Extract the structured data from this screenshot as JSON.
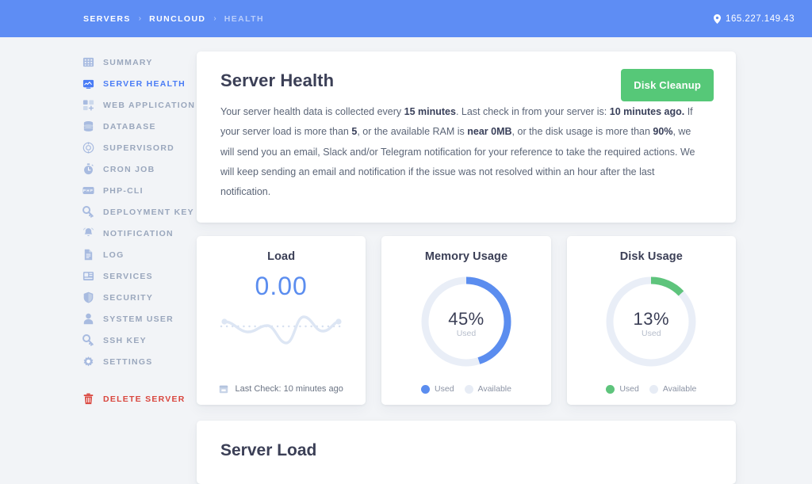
{
  "topbar": {
    "breadcrumbs": [
      {
        "label": "SERVERS",
        "muted": false
      },
      {
        "label": "RUNCLOUD",
        "muted": false
      },
      {
        "label": "HEALTH",
        "muted": true
      }
    ],
    "separator": "›",
    "ip_address": "165.227.149.43",
    "ip_icon": "location-pin-icon",
    "background_color": "#5e8df4"
  },
  "sidebar": {
    "items": [
      {
        "label": "SUMMARY",
        "icon": "grid-summary-icon",
        "active": false
      },
      {
        "label": "SERVER HEALTH",
        "icon": "health-monitor-icon",
        "active": true
      },
      {
        "label": "WEB APPLICATION",
        "icon": "web-application-icon",
        "active": false
      },
      {
        "label": "DATABASE",
        "icon": "database-icon",
        "active": false
      },
      {
        "label": "SUPERVISORD",
        "icon": "supervisord-gear-icon",
        "active": false
      },
      {
        "label": "CRON JOB",
        "icon": "stopwatch-icon",
        "active": false
      },
      {
        "label": "PHP-CLI",
        "icon": "php-badge-icon",
        "active": false
      },
      {
        "label": "DEPLOYMENT KEY",
        "icon": "key-icon",
        "active": false
      },
      {
        "label": "NOTIFICATION",
        "icon": "bell-icon",
        "active": false
      },
      {
        "label": "LOG",
        "icon": "document-icon",
        "active": false
      },
      {
        "label": "SERVICES",
        "icon": "services-icon",
        "active": false
      },
      {
        "label": "SECURITY",
        "icon": "shield-icon",
        "active": false
      },
      {
        "label": "SYSTEM USER",
        "icon": "user-icon",
        "active": false
      },
      {
        "label": "SSH KEY",
        "icon": "key-icon",
        "active": false
      },
      {
        "label": "SETTINGS",
        "icon": "gear-icon",
        "active": false
      }
    ],
    "delete": {
      "label": "DELETE SERVER",
      "icon": "trash-icon",
      "color": "#d9453d"
    },
    "active_color": "#4a7cf5",
    "idle_color": "#9aa7bd"
  },
  "main": {
    "title": "Server Health",
    "cleanup_button": {
      "label": "Disk Cleanup",
      "color": "#56c878"
    },
    "description": {
      "p1_a": "Your server health data is collected every ",
      "p1_b1": "15 minutes",
      "p1_c": ". Last check in from your server is: ",
      "p1_b2": "10 minutes ago.",
      "p1_d": " If your server load is more than ",
      "p1_b3": "5",
      "p1_e": ", or the available RAM is ",
      "p1_b4": "near 0MB",
      "p1_f": ", or the disk usage is more than ",
      "p1_b5": "90%",
      "p1_g": ", we will send you an email, Slack and/or Telegram notification for your reference to take the required actions. We will keep sending an email and notification if the issue was not resolved within an hour after the last notification."
    }
  },
  "stats": {
    "load": {
      "title": "Load",
      "value": "0.00",
      "value_color": "#5b8def",
      "last_check_label": "Last Check: 10 minutes ago",
      "calendar_icon": "calendar-icon"
    },
    "memory": {
      "title": "Memory Usage",
      "percent_label": "45%",
      "sub_label": "Used",
      "used_percent": 45,
      "color": "#5b8def",
      "track_color": "#e9eef7",
      "legend": [
        {
          "label": "Used",
          "color": "#5b8def"
        },
        {
          "label": "Available",
          "color": "#e7ecf5"
        }
      ]
    },
    "disk": {
      "title": "Disk Usage",
      "percent_label": "13%",
      "sub_label": "Used",
      "used_percent": 13,
      "color": "#5ec47c",
      "track_color": "#e9eef7",
      "legend": [
        {
          "label": "Used",
          "color": "#5ec47c"
        },
        {
          "label": "Available",
          "color": "#e7ecf5"
        }
      ]
    }
  },
  "server_load": {
    "title": "Server Load"
  },
  "chart_data": [
    {
      "type": "line",
      "title": "Load",
      "series": [
        {
          "name": "Load",
          "values": [
            0.35,
            0.18,
            0.12,
            0.3,
            0.42,
            0.3,
            0.06,
            -0.35,
            0.05,
            0.55,
            0.72,
            0.35,
            0.1,
            0.22,
            0.16,
            0.4
          ]
        }
      ],
      "x": [
        0,
        1,
        2,
        3,
        4,
        5,
        6,
        7,
        8,
        9,
        10,
        11,
        12,
        13,
        14,
        15
      ],
      "ylabel": "",
      "xlabel": "",
      "grid": false,
      "legend": "none"
    },
    {
      "type": "pie",
      "title": "Memory Usage",
      "categories": [
        "Used",
        "Available"
      ],
      "values": [
        45,
        55
      ],
      "colors": [
        "#5b8def",
        "#e7ecf5"
      ],
      "legend": "bottom"
    },
    {
      "type": "pie",
      "title": "Disk Usage",
      "categories": [
        "Used",
        "Available"
      ],
      "values": [
        13,
        87
      ],
      "colors": [
        "#5ec47c",
        "#e7ecf5"
      ],
      "legend": "bottom"
    }
  ]
}
